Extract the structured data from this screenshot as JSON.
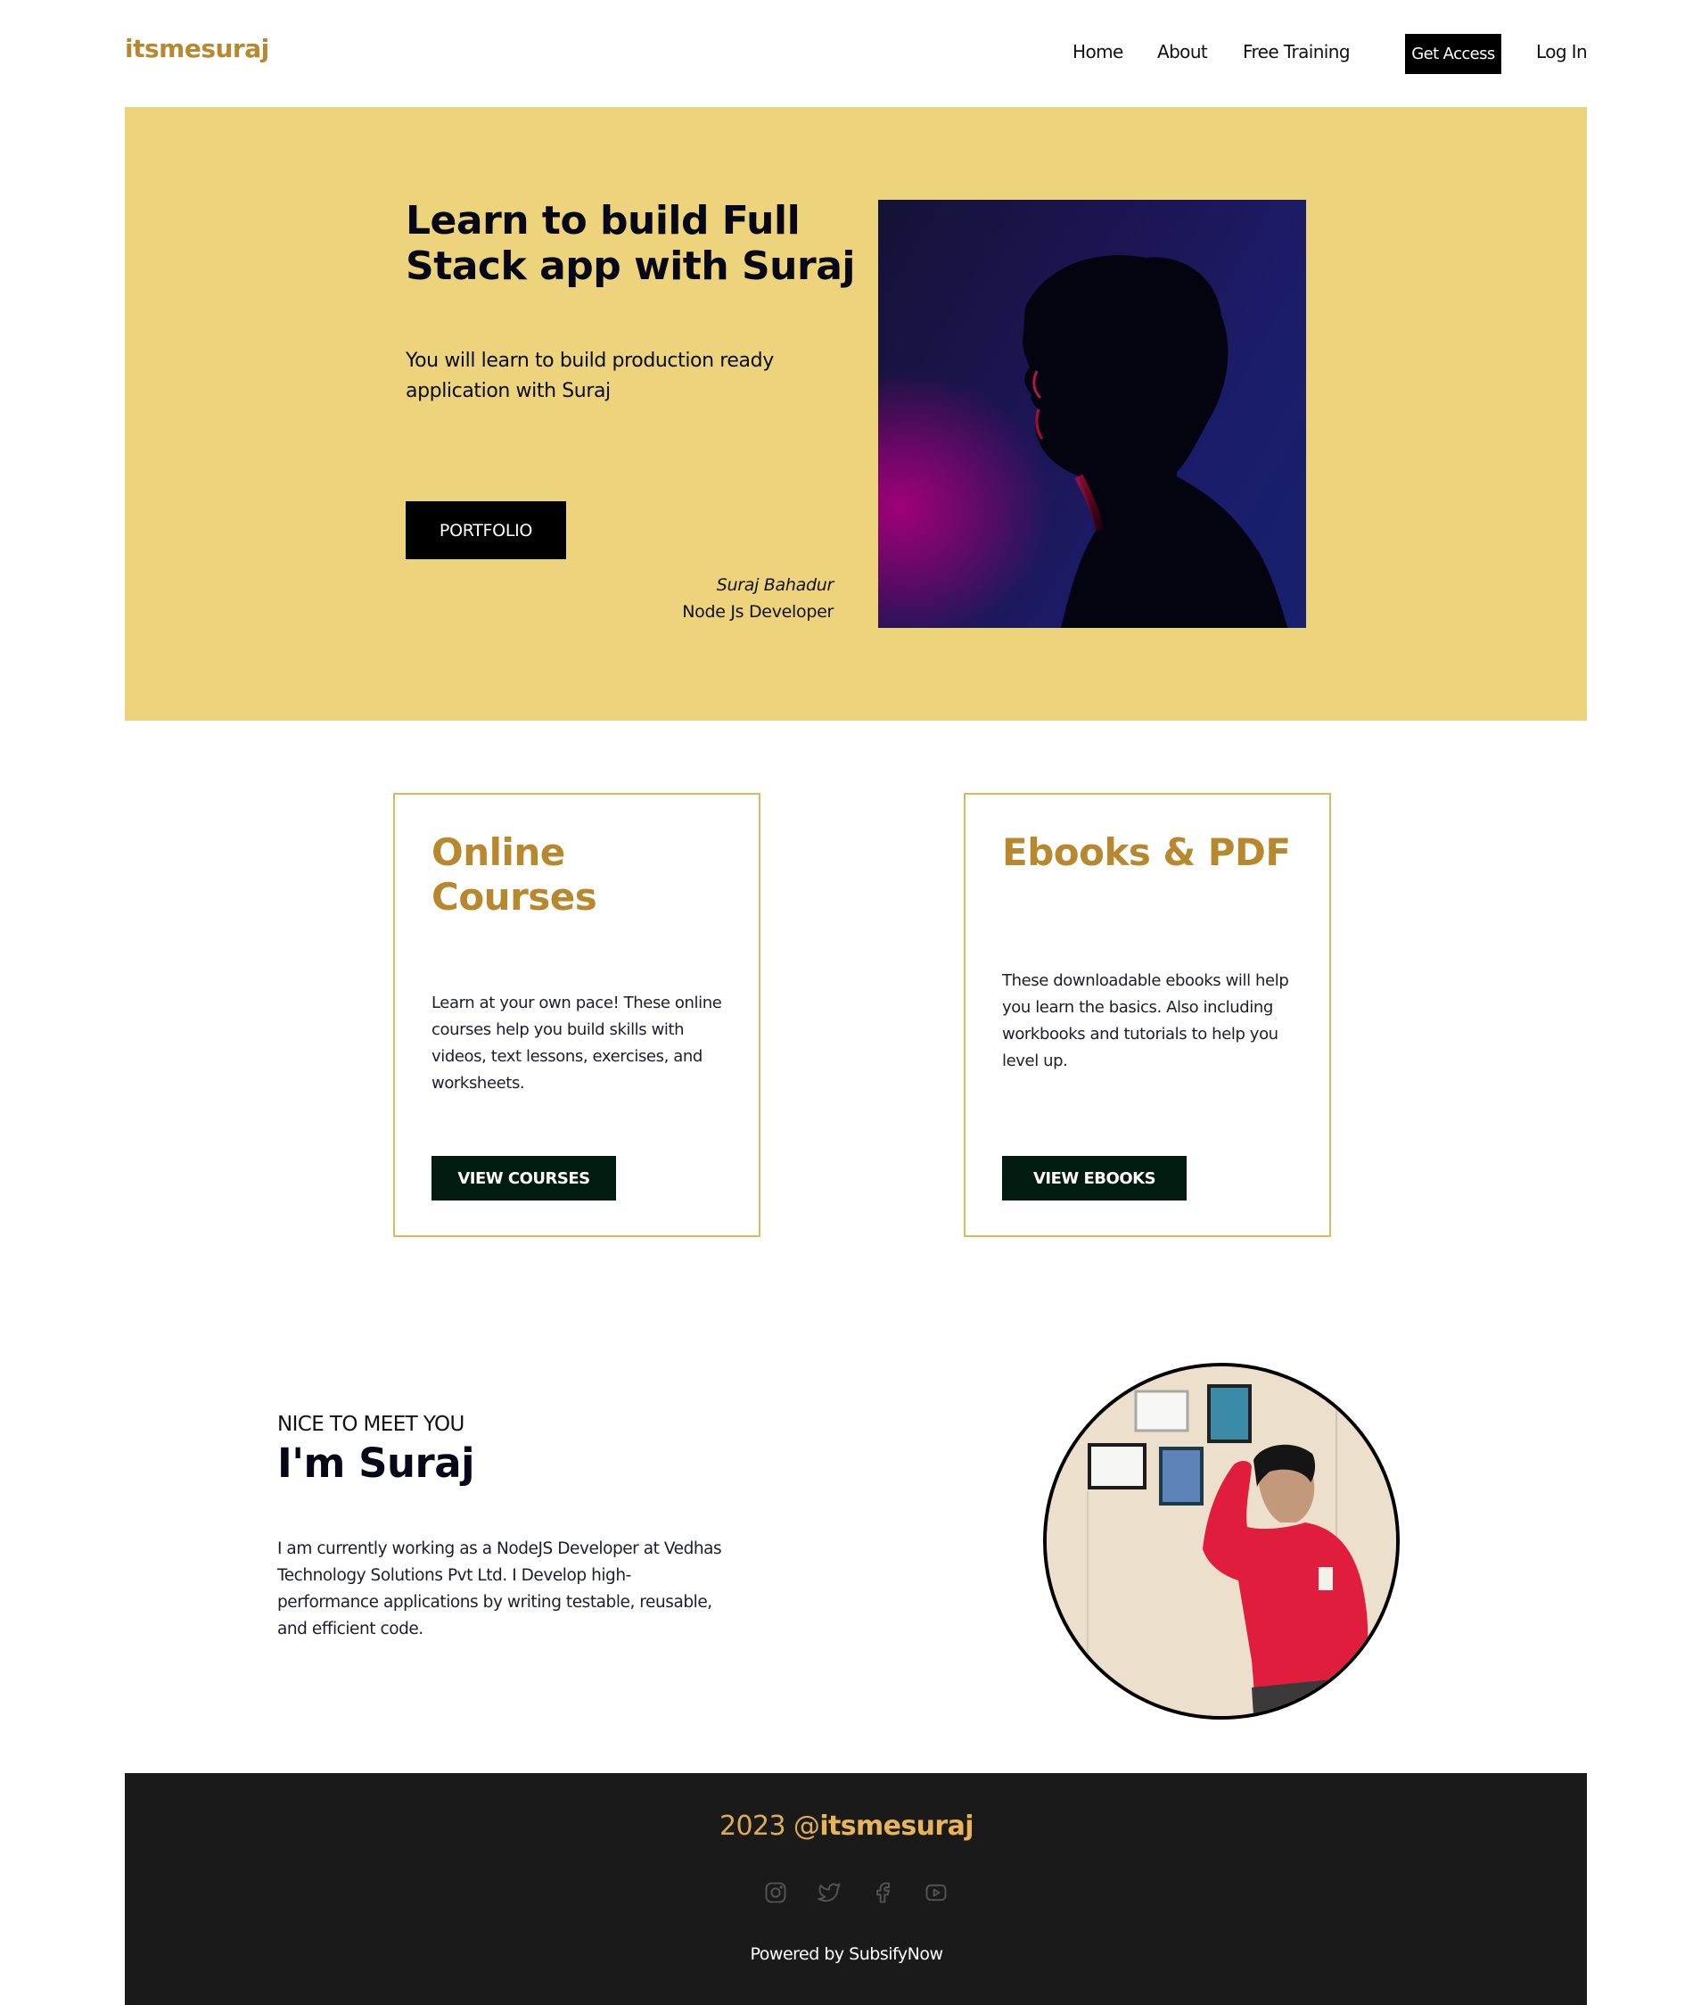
{
  "header": {
    "logo": "itsmesuraj",
    "nav": [
      {
        "label": "Home"
      },
      {
        "label": "About"
      },
      {
        "label": "Free Training"
      }
    ],
    "cta_label": "Get Access",
    "login_label": "Log In"
  },
  "hero": {
    "title": "Learn to build Full Stack app with Suraj",
    "subtitle": "You will learn to build production ready application with Suraj",
    "button_label": "PORTFOLIO",
    "author_name": "Suraj Bahadur",
    "author_role": "Node Js Developer",
    "image_alt": "Silhouette portrait in magenta and blue light"
  },
  "cards": [
    {
      "title": "Online Courses",
      "text": "Learn at your own pace! These online courses help you build skills with videos, text lessons, exercises, and worksheets.",
      "button_label": "VIEW COURSES"
    },
    {
      "title": "Ebooks & PDF",
      "text": "These downloadable ebooks will help you learn the basics. Also including workbooks and tutorials to help you level up.",
      "button_label": "VIEW EBOOKS"
    }
  ],
  "about": {
    "eyebrow": "NICE TO MEET YOU",
    "title": "I'm Suraj",
    "text": "I am currently working as a NodeJS Developer at Vedhas Technology Solutions Pvt Ltd. I Develop high-performance applications by writing testable, reusable, and efficient code.",
    "image_alt": "Suraj in a red hoodie"
  },
  "footer": {
    "year": "2023 @",
    "handle": "itsmesuraj",
    "social": [
      "instagram-icon",
      "twitter-icon",
      "facebook-icon",
      "youtube-icon"
    ],
    "powered_by": "Powered by SubsifyNow"
  },
  "colors": {
    "brand": "#b8882e",
    "hero_bg": "#ecd37c",
    "card_border": "#e0b85c",
    "card_button": "#031c12",
    "footer_bg": "#1a1a1a",
    "footer_brand": "#e8b45a",
    "social_icon": "#555555"
  }
}
